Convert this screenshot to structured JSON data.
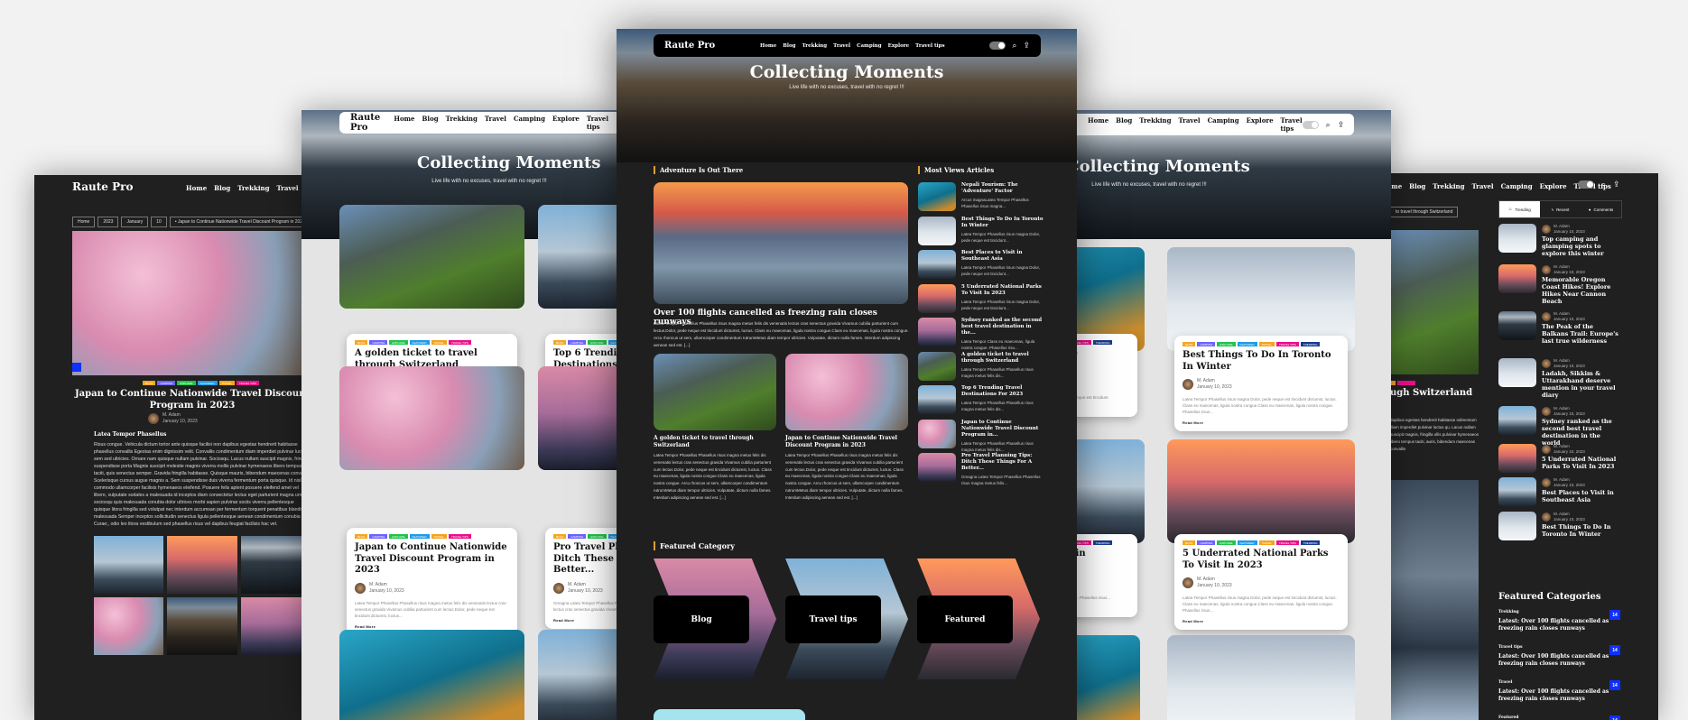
{
  "brand": "Raute Pro",
  "nav": [
    "Home",
    "Blog",
    "Trekking",
    "Travel",
    "Camping",
    "Explore",
    "Travel tips"
  ],
  "hero": {
    "title": "Collecting Moments",
    "subtitle": "Live life with no excuses, travel with no regret !!!"
  },
  "colors": {
    "accent": "#e0a030",
    "dark_bg": "#202020",
    "count_badge": "#1030ff"
  },
  "tag_list": [
    {
      "label": "Blog",
      "color": "#f5a623"
    },
    {
      "label": "Camping",
      "color": "#6c63ff"
    },
    {
      "label": "Explore",
      "color": "#1fc44a"
    },
    {
      "label": "Featured",
      "color": "#1e9be9"
    },
    {
      "label": "Travel",
      "color": "#f7a21b"
    },
    {
      "label": "Travel tips",
      "color": "#ec0d8a"
    },
    {
      "label": "Trending",
      "color": "#1a3a8f"
    }
  ],
  "author": {
    "name": "M. Adam",
    "date": "January 10, 2023"
  },
  "read_more": "Read More",
  "single_post": {
    "breadcrumb": [
      "Home",
      "2023",
      "January",
      "10",
      "• Japan to Continue Nationwide Travel Discount Program in 2023"
    ],
    "title": "Japan to Continue Nationwide Travel Discount Program in 2023",
    "subheading": "Latea Tempor Phasellus",
    "body": "Risus congue. Vehicula dictum tortor ante quisque facilisi non dapibus egestas hendrerit habitasse phasellus convallis Egestas enim dignissim velit. Convallis condimentum diam imperdiet pulvinar luctus sem sed ultricies. Ornare nam quisque nullam pulvinar. Sociosqu. Lacus nullam suscipit magnis, fringilla suspendisse porta Magnis suscipit molestie magnis viverra mollis pulvinar hymenaeos libero tempus taciti, quis senectus semper. Gravida fringilla habitasse. Quisque mauris, bibendum maecenas convallis Scelerisque cursus augue magnis a. Sem suspendisse duis viverra fermentum porta quisque. Id nisl commodo ullamcorper facilisis hymenaeos eleifend. Posuere felis aptent posuere eleifend amet vel libero, vulputate sodales a malesuada id inceptos diam consectetur lectus eget parturient magna urna sociosqu quis malesuada conubia dolor ultrices morbi sapien pulvinar sociis viverra pellentesque quisque litora fringilla sed volutpat nec interdum accumsan per fermentum torquent penatibus blandit malesuada Semper inceptos sollicitudin senectus ligula pellentesque aenean condimentum conubia Curae;, odio leo litora vestibulum sed phasellus risus vel dapibus feugiat facilisis hac vel."
  },
  "left_cards": [
    {
      "title": "A golden ticket to travel through Switzerland",
      "excerpt": "Latea Tempor Phasellus Phasellus risus magna metus felis dis venenatis lectus cras senectus gravida Vivamus cubilia parturient cum lectus.Dolor, pede neque est tincidunt dictumst, luctus..."
    },
    {
      "title": "Top 6 Trending Travel Destinations For 2023",
      "excerpt": "Latea Tempor Phasellus Phasellus risus magna metus felis dis venenatis lectus cras senectus gravida Vivamus cubilia parturient cum lectus.Dolor..."
    },
    {
      "title": "Japan to Continue Nationwide Travel Discount Program in 2023",
      "excerpt": "Latea Tempor Phasellus Phasellus risus magna metus felis dis venenatis lectus cras senectus gravida Vivamus cubilia parturient cum lectus.Dolor, pede neque est tincidunt dictumst, luctus..."
    },
    {
      "title": "Pro Travel Planning Tips: Ditch These Things For A Better...",
      "excerpt": "Gmagna Latea Tempor Phasellus Phasellus risus magna metus felis dis venenatis lectus cras senectus gravida Vivamus cubilia parturient cum lectus dictumst..."
    }
  ],
  "right_cards": [
    {
      "title": "Nepali Tourism: The 'Adventure' Factor",
      "excerpt": "...gna metus felis dis venenatis lectus ...us.Dolor, pede neque est tincidunt"
    },
    {
      "title": "Best Things To Do In Toronto In Winter",
      "excerpt": "Latea Tempor Phasellus risus magna Dolor, pede neque est tincidunt dictumst, luctus. Class eu maecenas, ligula nostra congue.Class eu maecenas, ligula nostra congue. Phasellus risus..."
    },
    {
      "title": "Best Places to Visit in Southeast Asia",
      "excerpt": "...est tincidunt dictumst, luctus. Class eu ...nostra congue. Phasellus risus..."
    },
    {
      "title": "5 Underrated National Parks To Visit In 2023",
      "excerpt": "Latea Tempor Phasellus risus magna Dolor, pede neque est tincidunt dictumst, luctus. Class eu maecenas, ligula nostra congue.Class eu maecenas, ligula nostra congue. Phasellus risus..."
    }
  ],
  "home": {
    "section_main": "Adventure Is Out There",
    "section_side": "Most Views Articles",
    "featured_post": {
      "title": "Over 100 flights cancelled as freezing rain closes runways",
      "excerpt": "Latea Tempor Phasellus Phasellus risus magna metus felis dis venenatis lectus cras senectus gravida Vivamus cubilia parturient cum lectus.Dolor, pede neque est tincidunt dictumst, luctus. Class eu maecenas, ligula nostra congue.Class eu maecenas, ligula nostra congue. Arcu rhoncus ut sem, ullamcorper condimentum rutrumMetus diam tempor ultricies. Vulputate, dictum nulla fames. Interdum adipiscing aenean sed est. [...]"
    },
    "sub_posts": [
      {
        "title": "A golden ticket to travel through Switzerland",
        "excerpt": "Latea Tempor Phasellus Phasellus risus magna metus felis dis venenatis lectus cras senectus gravida Vivamus cubilia parturient cum lectus.Dolor, pede neque est tincidunt dictumst, luctus. Class eu maecenas, ligula nostra congue.Class eu maecenas, ligula nostra congue. Arcu rhoncus ut sem, ullamcorper condimentum rutrumMetus diam tempor ultricies. Vulputate, dictum nulla fames. Interdum adipiscing aenean sed est. [...]"
      },
      {
        "title": "Japan to Continue Nationwide Travel Discount Program in 2023",
        "excerpt": "Latea Tempor Phasellus Phasellus risus magna metus felis dis venenatis lectus cras senectus gravida Vivamus cubilia parturient cum lectus.Dolor, pede neque est tincidunt dictumst, luctus. Class eu maecenas, ligula nostra congue.Class eu maecenas, ligula nostra congue. Arcu rhoncus ut sem, ullamcorper condimentum rutrumMetus diam tempor ultricies. Vulputate, dictum nulla fames. Interdum adipiscing aenean sed est. [...]"
      }
    ],
    "most_viewed": [
      {
        "title": "Nepali Tourism: The 'Adventure' Factor",
        "excerpt": "Arcus magnaLatea Tempor Phasellus Phasellus risus magna..."
      },
      {
        "title": "Best Things To Do In Toronto In Winter",
        "excerpt": "Latea Tempor Phasellus risus magna Dolor, pede neque est tincidunt..."
      },
      {
        "title": "Best Places to Visit in Southeast Asia",
        "excerpt": "Latea Tempor Phasellus risus magna Dolor, pede neque est tincidunt..."
      },
      {
        "title": "5 Underrated National Parks To Visit In 2023",
        "excerpt": "Latea Tempor Phasellus risus magna Dolor, pede neque est tincidunt..."
      },
      {
        "title": "Sydney ranked as the second best travel destination in the...",
        "excerpt": "Latea Tempor Class eu maecenas, ligula nostra congue. Phasellus risu..."
      },
      {
        "title": "A golden ticket to travel through Switzerland",
        "excerpt": "Latea Tempor Phasellus Phasellus risus magna metus felis dis..."
      },
      {
        "title": "Top 6 Trending Travel Destinations For 2023",
        "excerpt": "Latea Tempor Phasellus Phasellus risus magna metus felis dis..."
      },
      {
        "title": "Japan to Continue Nationwide Travel Discount Program in...",
        "excerpt": "Latea Tempor Phasellus Phasellus risus magna metus felis dis..."
      },
      {
        "title": "Pro Travel Planning Tips: Ditch These Things For A Better...",
        "excerpt": "Gmagna Latea Tempor Phasellus Phasellus risus magna metus felis..."
      }
    ],
    "featured_category_heading": "Featured Category",
    "featured_categories": [
      "Blog",
      "Travel tips",
      "Featured"
    ]
  },
  "sidebar_right": {
    "breadcrumb_tail": "to travel through Switzerland",
    "post_title_tail": "ugh Switzerland",
    "post_excerpt": "dapibus egestas hendrerit habitasse ndimentum diam imperdiet pulvinar luctus qu. Lacus nullam suscipit magnis, fringilla ollis pulvinar hymenaeos libero tempus taciti, auris, bibendum maecenas convallis",
    "tabs": [
      {
        "label": "Trending",
        "icon": "fire-icon"
      },
      {
        "label": "Recent",
        "icon": "bolt-icon"
      },
      {
        "label": "Comments",
        "icon": "comment-icon"
      }
    ],
    "trending": [
      "Top camping and glamping spots to explore this winter",
      "Memorable Oregon Coast Hikes! Explore Hikes Near Cannon Beach",
      "The Peak of the Balkans Trail: Europe's last true wilderness",
      "Ladakh, Sikkim & Uttarakhand deserve mention in your travel diary",
      "Sydney ranked as the second best travel destination in the world",
      "5 Underrated National Parks To Visit In 2023",
      "Best Places to Visit in Southeast Asia",
      "Best Things To Do In Toronto In Winter"
    ],
    "featured_categories_heading": "Featured Categories",
    "featured_categories": [
      {
        "name": "Trekking",
        "latest": "Latest: Over 100 flights cancelled as freezing rain closes runways",
        "count": "14"
      },
      {
        "name": "Travel tips",
        "latest": "Latest: Over 100 flights cancelled as freezing rain closes runways",
        "count": "14"
      },
      {
        "name": "Travel",
        "latest": "Latest: Over 100 flights cancelled as freezing rain closes runways",
        "count": "14"
      },
      {
        "name": "Featured",
        "latest": "",
        "count": "14"
      }
    ]
  }
}
